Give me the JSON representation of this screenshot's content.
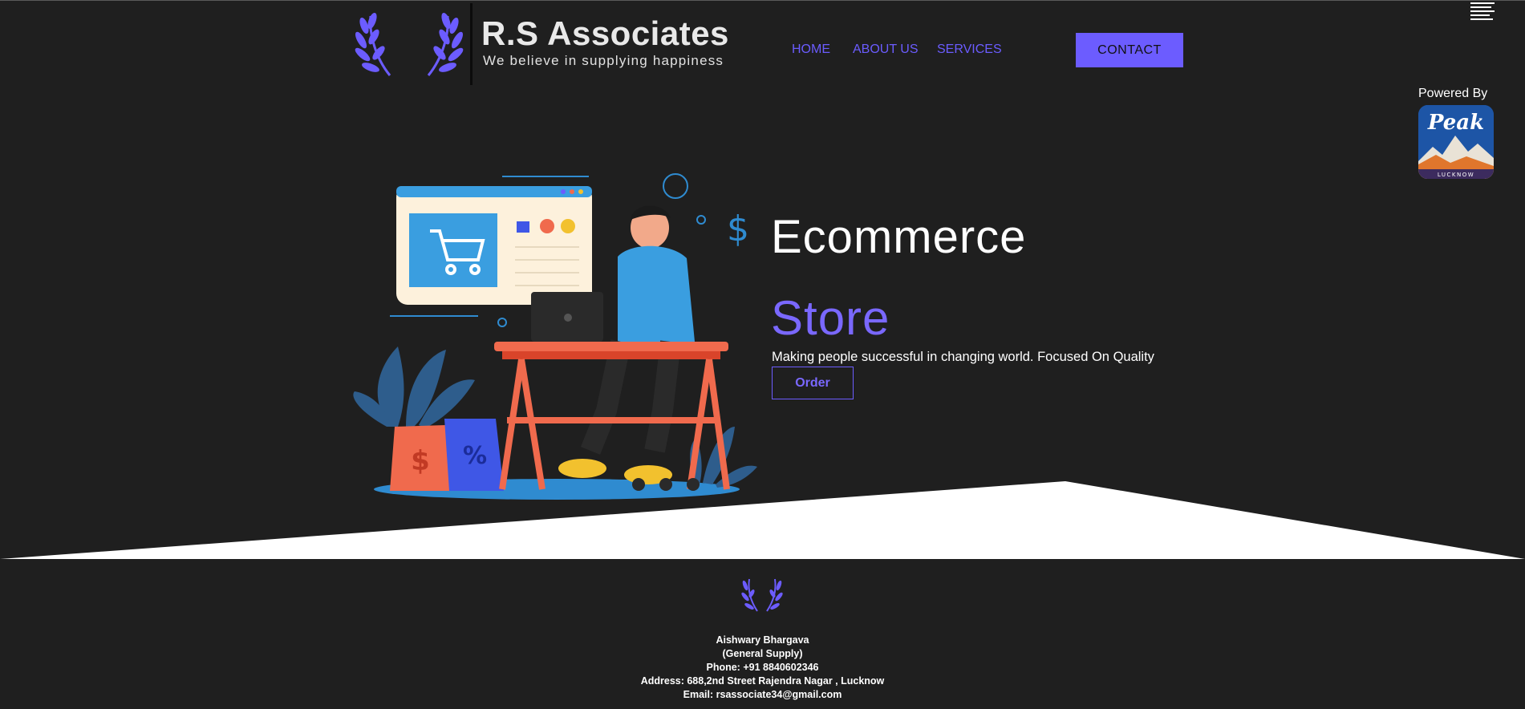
{
  "brand": {
    "title": "R.S Associates",
    "tagline": "We believe in supplying happiness",
    "accent_color": "#6c5cff"
  },
  "nav": {
    "items": [
      "HOME",
      "ABOUT US",
      "SERVICES"
    ],
    "contact_label": "CONTACT"
  },
  "powered": {
    "label": "Powered By",
    "badge_text": "Peak",
    "badge_subtext": "LUCKNOW"
  },
  "hero": {
    "heading": "Ecommerce",
    "accent": "Store",
    "text": "Making people successful in changing world. Focused On Quality",
    "order_label": "Order"
  },
  "footer": {
    "name": "Aishwary Bhargava",
    "role": "(General Supply)",
    "phone": "Phone: +91 8840602346",
    "address": "Address: 688,2nd Street Rajendra Nagar , Lucknow",
    "email": "Email: rsassociate34@gmail.com"
  },
  "icons": [
    "laurel-logo-icon",
    "menu-icon",
    "peak-badge-icon",
    "cart-icon",
    "like-icon",
    "heart-icon",
    "dollar-icon",
    "percent-icon"
  ]
}
